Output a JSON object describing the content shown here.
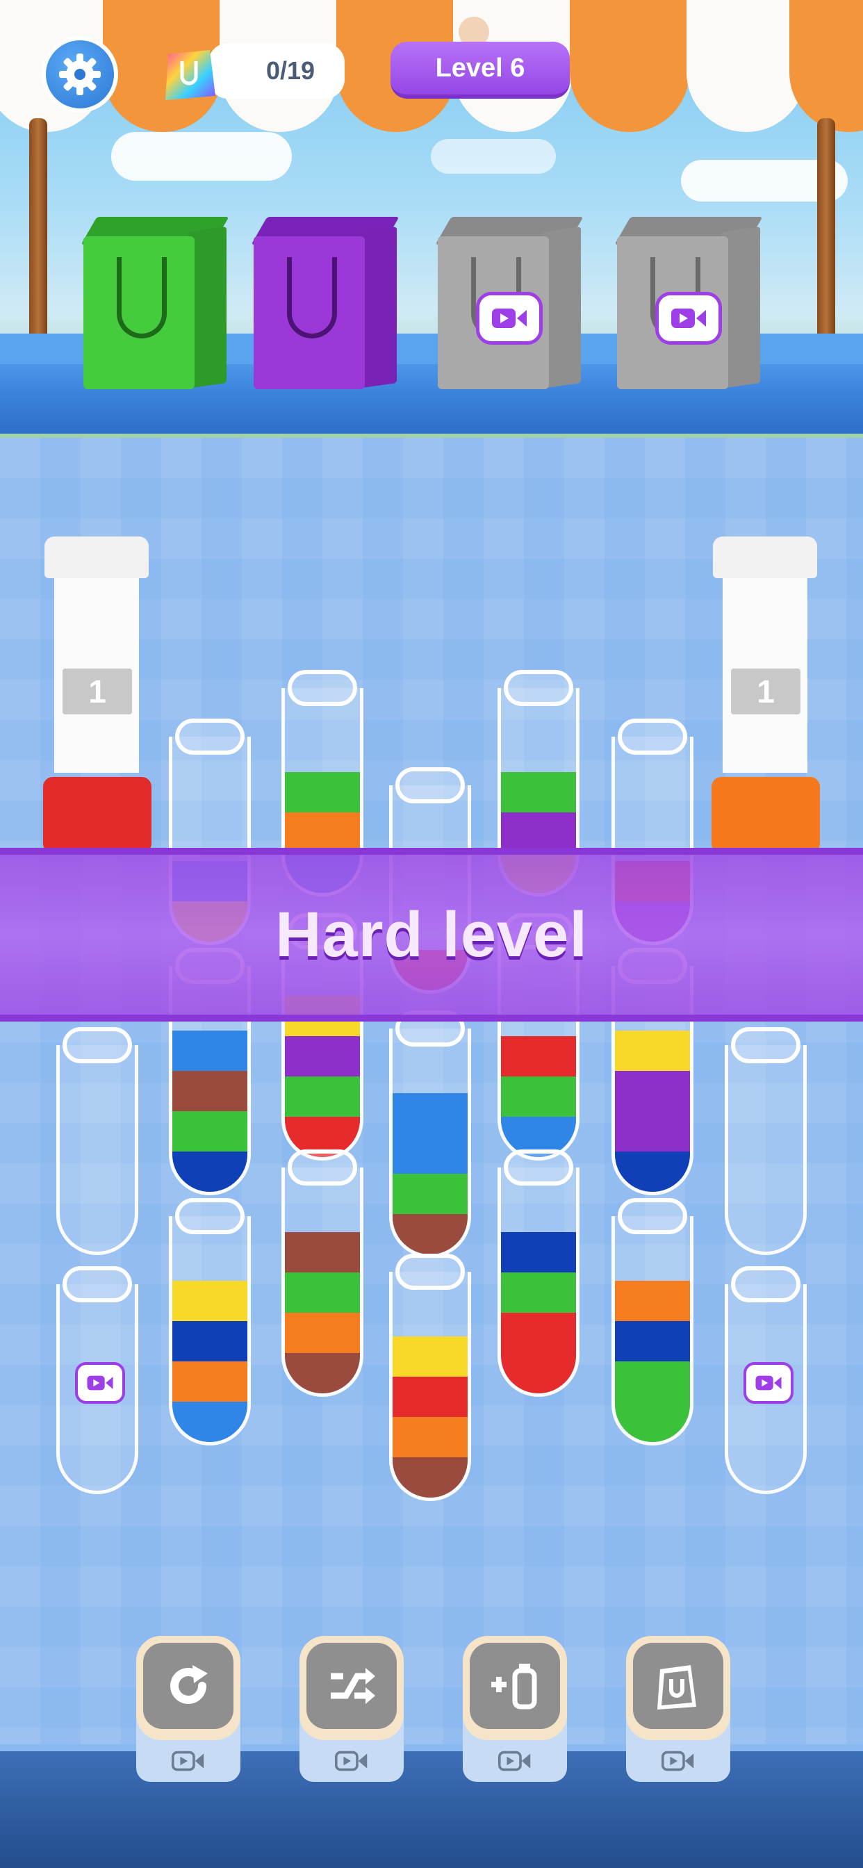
{
  "hud": {
    "bag_progress": "0/19",
    "level_label": "Level 6"
  },
  "colors": {
    "red": "#e52b2b",
    "green": "#3cc13a",
    "orange": "#f57d1f",
    "blue": "#2f86e6",
    "navy": "#1040b8",
    "purple": "#8e2fc9",
    "yellow": "#f8d829",
    "brown": "#9b4a3e"
  },
  "bags": [
    {
      "color": "green",
      "locked": false
    },
    {
      "color": "purple",
      "locked": false
    },
    {
      "color": "gray",
      "locked": true
    },
    {
      "color": "gray",
      "locked": true
    }
  ],
  "stands": [
    {
      "number": "1"
    },
    {
      "number": "1"
    }
  ],
  "banner": {
    "text": "Hard level"
  },
  "tubes_row1": [
    {
      "layers_top_to_bottom": [
        "blue",
        "yellow"
      ]
    },
    {
      "layers_top_to_bottom": [
        "green",
        "orange",
        "blue"
      ]
    },
    {
      "layers_top_to_bottom": [
        "red"
      ]
    },
    {
      "layers_top_to_bottom": [
        "green",
        "purple",
        "yellow"
      ]
    },
    {
      "layers_top_to_bottom": [
        "red",
        "purple"
      ]
    }
  ],
  "tubes_row2": [
    {
      "layers_top_to_bottom": [
        "blue",
        "brown",
        "green",
        "navy"
      ]
    },
    {
      "layers_top_to_bottom": [
        "yellow",
        "purple",
        "green",
        "red"
      ]
    },
    {
      "layers_top_to_bottom": [
        "blue",
        "blue",
        "green",
        "brown"
      ]
    },
    {
      "layers_top_to_bottom": [
        "red",
        "green",
        "blue"
      ]
    },
    {
      "layers_top_to_bottom": [
        "yellow",
        "purple",
        "purple",
        "navy"
      ]
    }
  ],
  "tubes_row3": [
    {
      "layers_top_to_bottom": [
        "yellow",
        "navy",
        "orange",
        "blue"
      ]
    },
    {
      "layers_top_to_bottom": [
        "brown",
        "green",
        "orange",
        "brown"
      ]
    },
    {
      "layers_top_to_bottom": [
        "yellow",
        "red",
        "orange",
        "brown"
      ]
    },
    {
      "layers_top_to_bottom": [
        "navy",
        "green",
        "red",
        "red"
      ]
    },
    {
      "layers_top_to_bottom": [
        "orange",
        "navy",
        "green",
        "green"
      ]
    }
  ],
  "toolbar": [
    {
      "name": "undo",
      "icon": "undo-icon"
    },
    {
      "name": "shuffle",
      "icon": "shuffle-icon"
    },
    {
      "name": "add-tube",
      "icon": "add-tube-icon"
    },
    {
      "name": "add-bag",
      "icon": "bag-icon"
    }
  ]
}
